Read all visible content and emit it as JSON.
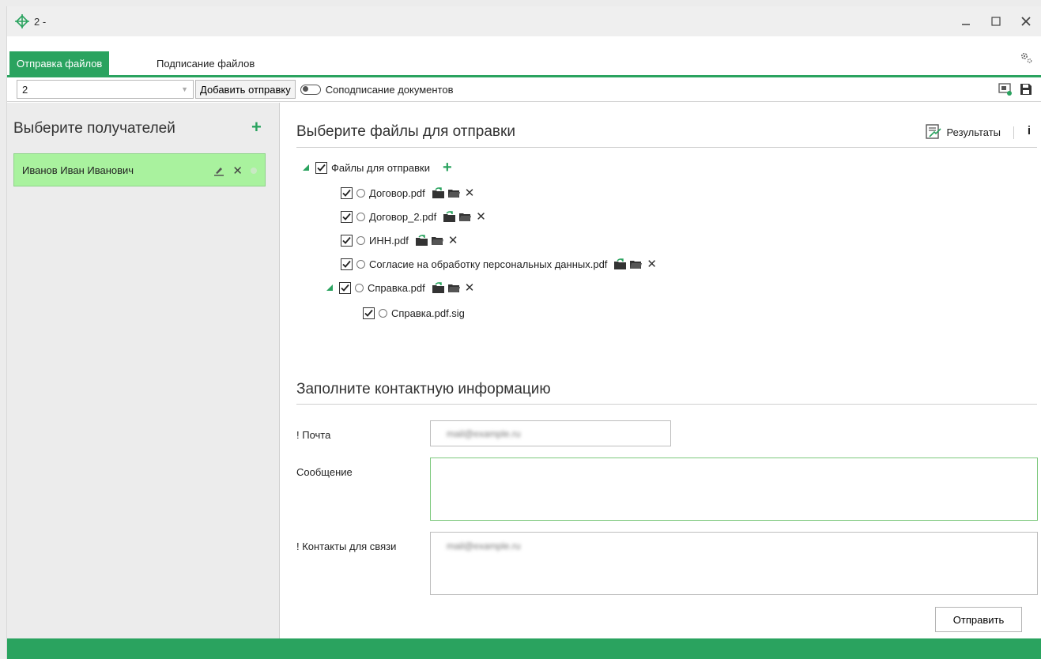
{
  "window": {
    "title": "2 -"
  },
  "tabs": [
    {
      "label": "Отправка файлов",
      "active": true
    },
    {
      "label": "Подписание файлов",
      "active": false
    }
  ],
  "toolbar": {
    "combo_value": "2",
    "add_button": "Добавить отправку",
    "cosign_label": "Соподписание документов",
    "cosign_enabled": false
  },
  "left": {
    "heading": "Выберите получателей",
    "recipients": [
      {
        "name": "Иванов Иван Иванович"
      }
    ]
  },
  "files": {
    "heading": "Выберите файлы для отправки",
    "results_label": "Результаты",
    "info_label": "i",
    "root": "Файлы для отправки",
    "items": [
      {
        "name": "Договор.pdf",
        "checked": true
      },
      {
        "name": "Договор_2.pdf",
        "checked": true
      },
      {
        "name": "ИНН.pdf",
        "checked": true
      },
      {
        "name": "Согласие на обработку персональных данных.pdf",
        "checked": true
      },
      {
        "name": "Справка.pdf",
        "checked": true,
        "expanded": true
      },
      {
        "name": "Справка.pdf.sig",
        "checked": true
      }
    ]
  },
  "contact": {
    "heading": "Заполните контактную информацию",
    "email_label": "! Почта",
    "email_value": "mail@example.ru",
    "message_label": "Сообщение",
    "message_value": "",
    "contacts_label": "! Контакты для связи",
    "contacts_value": "mail@example.ru",
    "send_button": "Отправить"
  },
  "colors": {
    "accent": "#2aa35f",
    "recipient_bg": "#a9f29e"
  }
}
